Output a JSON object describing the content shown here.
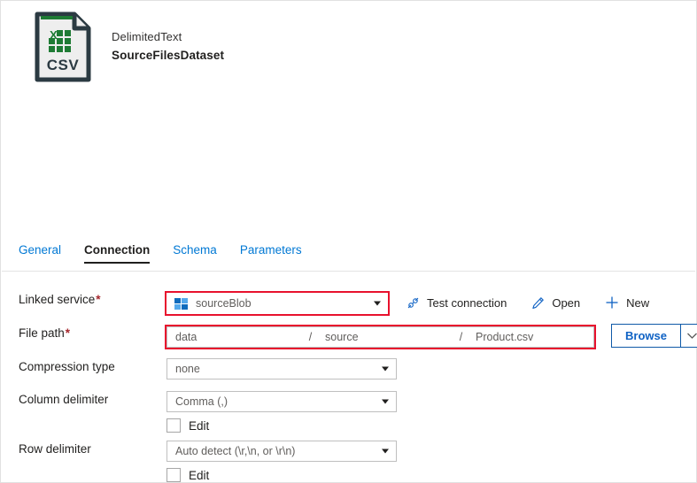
{
  "header": {
    "icon_name": "csv-file-icon",
    "icon_label": "CSV",
    "dataset_type": "DelimitedText",
    "dataset_name": "SourceFilesDataset"
  },
  "tabs": [
    {
      "label": "General",
      "active": false
    },
    {
      "label": "Connection",
      "active": true
    },
    {
      "label": "Schema",
      "active": false
    },
    {
      "label": "Parameters",
      "active": false
    }
  ],
  "form": {
    "linked_service": {
      "label": "Linked service",
      "required": "*",
      "value": "sourceBlob",
      "icon": "azure-blob-storage-icon",
      "highlighted": true
    },
    "actions": [
      {
        "label": "Test connection",
        "icon": "plug-icon"
      },
      {
        "label": "Open",
        "icon": "pencil-icon"
      },
      {
        "label": "New",
        "icon": "plus-icon"
      }
    ],
    "file_path": {
      "label": "File path",
      "required": "*",
      "container": "data",
      "directory": "source",
      "file_name": "Product.csv",
      "separator": "/",
      "highlighted": true
    },
    "browse": {
      "label": "Browse",
      "caret_icon": "chevron-down-icon"
    },
    "compression_type": {
      "label": "Compression type",
      "value": "none"
    },
    "column_delimiter": {
      "label": "Column delimiter",
      "value": "Comma (,)",
      "edit_label": "Edit",
      "edit_checked": false
    },
    "row_delimiter": {
      "label": "Row delimiter",
      "value": "Auto detect (\\r,\\n, or \\r\\n)",
      "edit_label": "Edit",
      "edit_checked": false
    }
  },
  "colors": {
    "accent": "#0078d4",
    "highlight": "#e8112d",
    "required": "#a4262c",
    "csv_green": "#1e7b34",
    "csv_outline": "#2b3a42"
  }
}
